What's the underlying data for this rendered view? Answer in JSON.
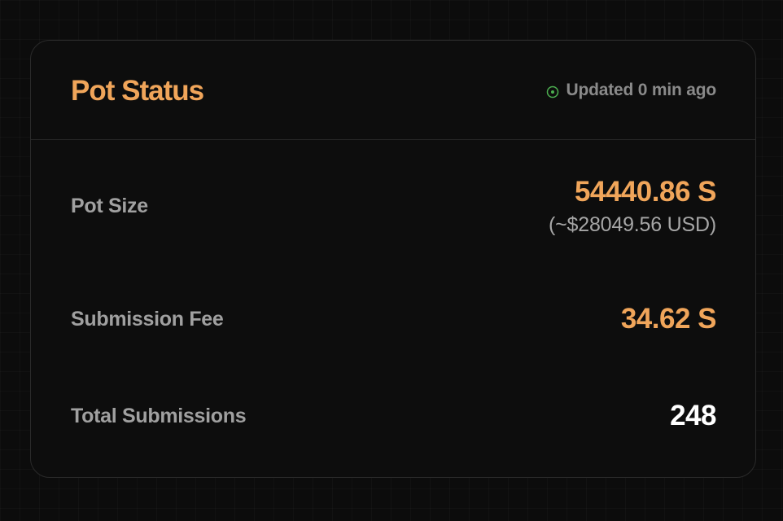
{
  "pot_status": {
    "title": "Pot Status",
    "updated_text": "Updated 0 min ago",
    "status_icon": "clock-icon",
    "rows": {
      "pot_size": {
        "label": "Pot Size",
        "value": "54440.86 S",
        "subvalue": "(~$28049.56 USD)"
      },
      "submission_fee": {
        "label": "Submission Fee",
        "value": "34.62 S"
      },
      "total_submissions": {
        "label": "Total Submissions",
        "value": "248"
      }
    }
  },
  "colors": {
    "accent": "#f0a55a",
    "status_green": "#4caf50",
    "background": "#0c0c0c",
    "card_background": "#0d0d0d"
  }
}
